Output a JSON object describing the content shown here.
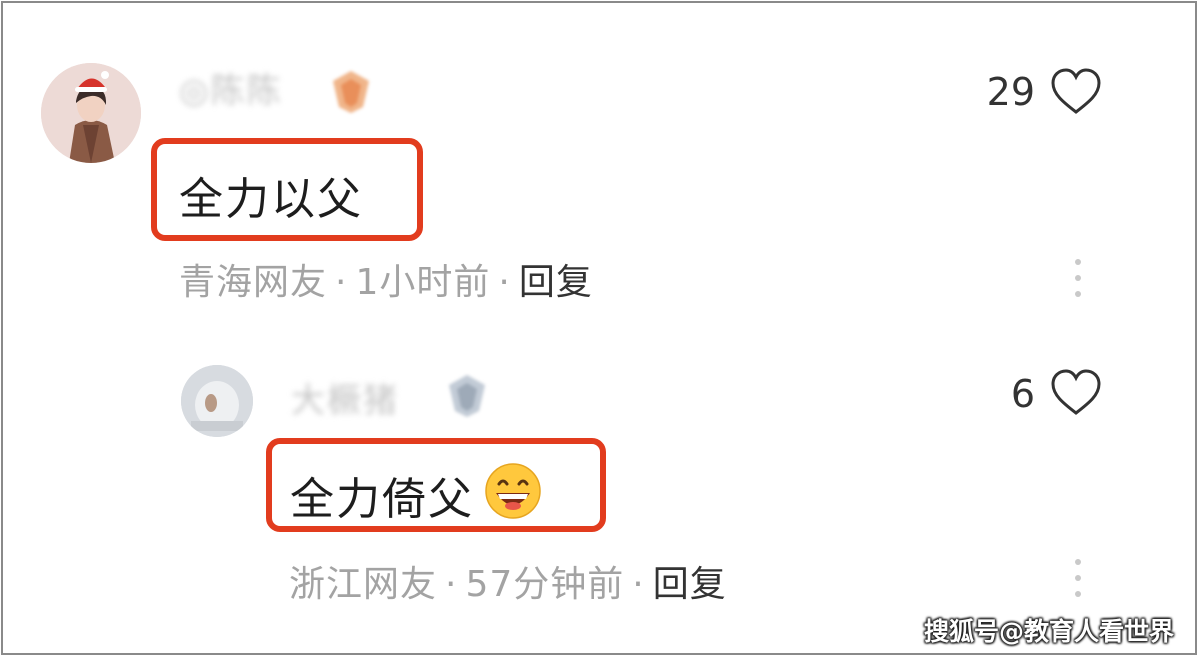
{
  "comments": [
    {
      "username": "◎陈陈",
      "like_count": "29",
      "text": "全力以父",
      "location": "青海网友",
      "time": "1小时前",
      "reply_label": "回复"
    },
    {
      "username": "大橛猪",
      "like_count": "6",
      "text": "全力倚父",
      "location": "浙江网友",
      "time": "57分钟前",
      "reply_label": "回复"
    }
  ],
  "separator": "·",
  "watermark": "搜狐号@教育人看世界",
  "colors": {
    "highlight_box": "#e23c1e",
    "meta_text": "#a3a3a3",
    "reply_text": "#333333"
  },
  "icons": {
    "like": "heart-outline-icon",
    "more": "more-vertical-icon",
    "emoji": "grinning-face-emoji"
  }
}
